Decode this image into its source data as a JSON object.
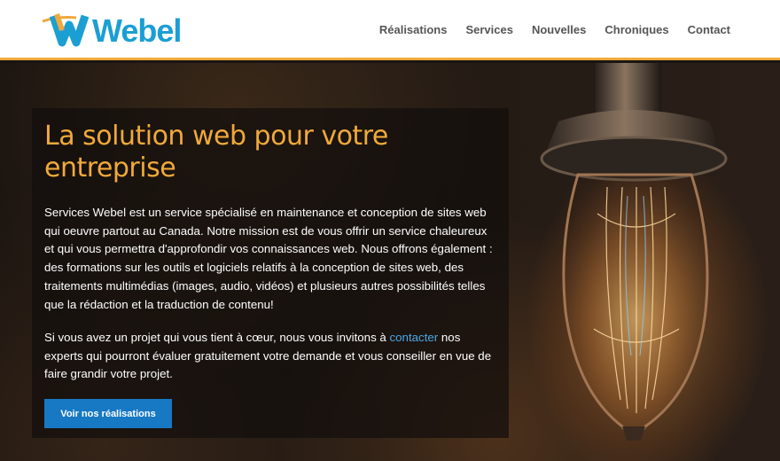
{
  "header": {
    "logo_text": "Webel",
    "nav": [
      "Réalisations",
      "Services",
      "Nouvelles",
      "Chroniques",
      "Contact"
    ]
  },
  "hero": {
    "headline": "La solution web pour votre entreprise",
    "paragraph1": "Services Webel est  un service spécialisé en maintenance et conception de sites web qui oeuvre partout au Canada. Notre mission est de vous offrir un service chaleureux et qui vous permettra d'approfondir vos connaissances web. Nous offrons également : des formations sur les outils et logiciels relatifs à la conception de sites web, des traitements multimédias (images, audio, vidéos) et plusieurs autres possibilités telles que la rédaction et la traduction de contenu!",
    "paragraph2_before": "Si vous avez un projet qui vous tient à cœur, nous vous invitons à ",
    "paragraph2_link": "contacter",
    "paragraph2_after": " nos experts qui pourront évaluer gratuitement votre demande et vous conseiller en vue de faire grandir votre projet.",
    "cta_label": "Voir nos réalisations"
  },
  "colors": {
    "accent_orange": "#f0a93a",
    "brand_blue": "#1b9fd3",
    "button_blue": "#1778c4",
    "link_blue": "#4aa8e6"
  },
  "icons": [
    "logo-w-icon",
    "light-bulb-image"
  ]
}
